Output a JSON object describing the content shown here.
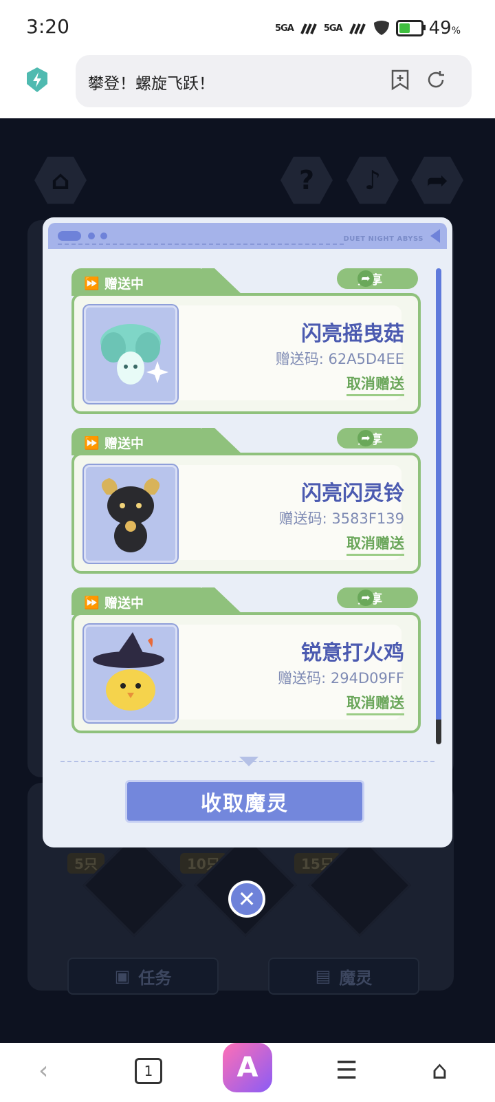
{
  "status_bar": {
    "time": "3:20",
    "signal_1": "5GA",
    "signal_2": "5GA",
    "battery_percent": "49",
    "battery_level": 0.49,
    "battery_unit": "%"
  },
  "browser": {
    "url_text": "攀登！螺旋飞跃！",
    "bookmark_icon": "bookmark-add-icon",
    "reload_icon": "reload-icon"
  },
  "game_background": {
    "counts": [
      "5只",
      "10只",
      "15只"
    ],
    "tab_task": "任务",
    "tab_spirit": "魔灵"
  },
  "dialog": {
    "header_tag": "DUET NIGHT ABYSS",
    "items": [
      {
        "status": "赠送中",
        "share": "分享",
        "name": "闪亮摇曳菇",
        "code": "赠送码: 62A5D4EE",
        "cancel": "取消赠送"
      },
      {
        "status": "赠送中",
        "share": "分享",
        "name": "闪亮闪灵铃",
        "code": "赠送码: 3583F139",
        "cancel": "取消赠送"
      },
      {
        "status": "赠送中",
        "share": "分享",
        "name": "锐意打火鸡",
        "code": "赠送码: 294D09FF",
        "cancel": "取消赠送"
      }
    ],
    "collect_button": "收取魔灵"
  },
  "nav_bar": {
    "tabs_count": "1",
    "app_letter": "A"
  },
  "colors": {
    "accent_blue": "#6e82d9",
    "accent_green": "#8fc17c",
    "game_bg": "#0d1220"
  }
}
